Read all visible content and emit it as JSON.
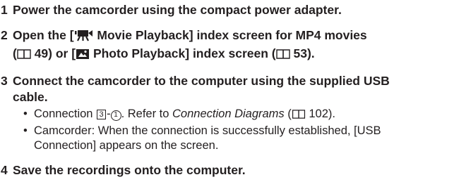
{
  "steps": [
    {
      "number": "1",
      "lines": [
        "Power the camcorder using the compact power adapter."
      ]
    },
    {
      "number": "2",
      "line1_pre": "Open the [",
      "line1_label": "Movie Playback] index screen for MP4 movies",
      "line2_pre": "(",
      "line2_page": "49) or [",
      "line2_label": "Photo Playback] index screen (",
      "line2_end": "53)."
    },
    {
      "number": "3",
      "lines": [
        "Connect the camcorder to the computer using the supplied USB",
        "cable."
      ],
      "bullets": [
        {
          "pre": "Connection ",
          "box": "3",
          "dash": "-",
          "circle": "1",
          "mid": ". Refer to ",
          "italic": "Connection Diagrams",
          "post": " (",
          "page": "102)."
        },
        {
          "lines": [
            "Camcorder: When the connection is successfully established, [USB",
            "Connection] appears on the screen."
          ]
        }
      ]
    },
    {
      "number": "4",
      "lines": [
        "Save the recordings onto the computer."
      ]
    }
  ],
  "icons": {
    "movie": "movie-playback-icon",
    "photo": "photo-playback-icon",
    "book": "book-reference-icon"
  }
}
